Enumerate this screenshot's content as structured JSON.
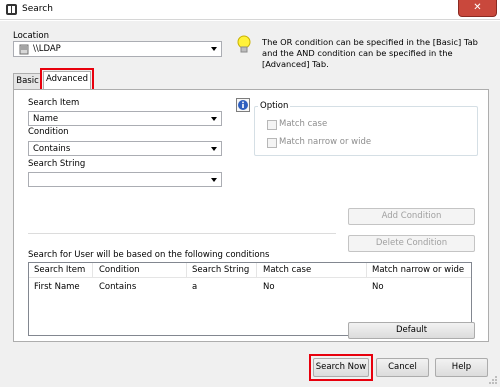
{
  "window": {
    "title": "Search",
    "close_glyph": "✕"
  },
  "location": {
    "label": "Location",
    "value": "\\\\LDAP"
  },
  "hint": {
    "text": "The OR condition can be specified in the [Basic] Tab and the AND condition can be specified in the [Advanced] Tab."
  },
  "tabs": [
    {
      "label": "Basic"
    },
    {
      "label": "Advanced"
    }
  ],
  "search_item": {
    "label": "Search Item",
    "value": "Name"
  },
  "condition": {
    "label": "Condition",
    "value": "Contains"
  },
  "search_string": {
    "label": "Search String",
    "value": ""
  },
  "option": {
    "label": "Option",
    "match_case": "Match case",
    "match_narrow_wide": "Match narrow or wide"
  },
  "buttons": {
    "add_condition": "Add Condition",
    "delete_condition": "Delete Condition",
    "default": "Default",
    "search_now": "Search Now",
    "cancel": "Cancel",
    "help": "Help"
  },
  "conditions": {
    "caption": "Search for User will be based on the following conditions",
    "columns": [
      "Search Item",
      "Condition",
      "Search String",
      "Match case",
      "Match narrow or wide"
    ],
    "rows": [
      [
        "First Name",
        "Contains",
        "a",
        "No",
        "No"
      ]
    ]
  },
  "colors": {
    "highlight": "#e8000d",
    "close_button": "#c9483c"
  }
}
